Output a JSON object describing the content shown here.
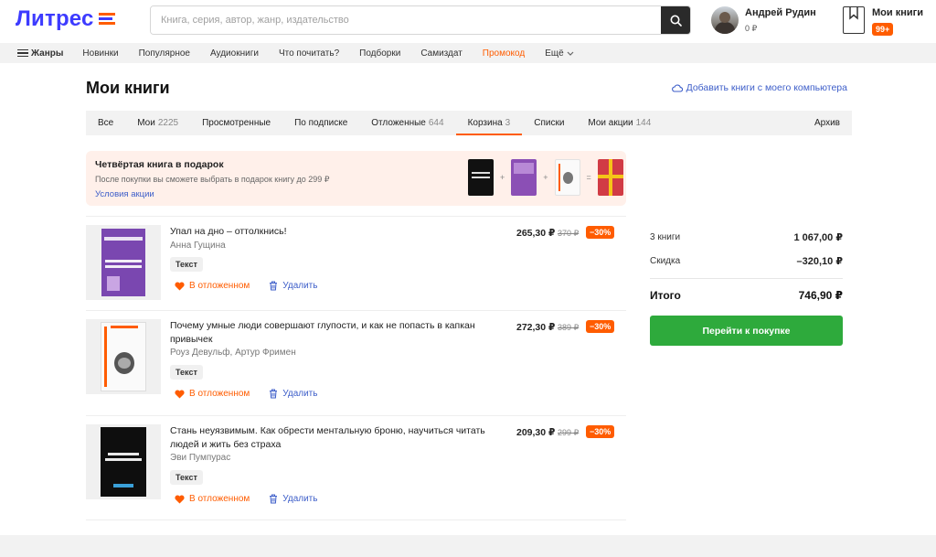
{
  "header": {
    "logo_text": "Литрес",
    "search_placeholder": "Книга, серия, автор, жанр, издательство",
    "user_name": "Андрей Рудин",
    "user_balance": "0 ₽",
    "mybooks_label": "Мои книги",
    "mybooks_badge": "99+"
  },
  "nav": {
    "genres": "Жанры",
    "items": [
      "Новинки",
      "Популярное",
      "Аудиокниги",
      "Что почитать?",
      "Подборки",
      "Самиздат"
    ],
    "promo": "Промокод",
    "more": "Ещё"
  },
  "page": {
    "title": "Мои книги",
    "add_link": "Добавить книги с моего компьютера"
  },
  "tabs": [
    {
      "label": "Все",
      "count": ""
    },
    {
      "label": "Мои",
      "count": "2225"
    },
    {
      "label": "Просмотренные",
      "count": ""
    },
    {
      "label": "По подписке",
      "count": ""
    },
    {
      "label": "Отложенные",
      "count": "644"
    },
    {
      "label": "Корзина",
      "count": "3"
    },
    {
      "label": "Списки",
      "count": ""
    },
    {
      "label": "Мои акции",
      "count": "144"
    }
  ],
  "tab_archive": "Архив",
  "promo": {
    "title": "Четвёртая книга в подарок",
    "subtitle": "После покупки вы сможете выбрать в подарок книгу до 299 ₽",
    "link": "Условия акции",
    "plus": "+",
    "equals": "="
  },
  "items": [
    {
      "title": "Упал на дно – оттолкнись!",
      "author": "Анна Гущина",
      "tag": "Текст",
      "price": "265,30 ₽",
      "old_price": "370 ₽",
      "discount": "−30%",
      "fav": "В отложенном",
      "delete": "Удалить"
    },
    {
      "title": "Почему умные люди совершают глупости, и как не попасть в капкан привычек",
      "author": "Роуз Девульф, Артур Фримен",
      "tag": "Текст",
      "price": "272,30 ₽",
      "old_price": "389 ₽",
      "discount": "−30%",
      "fav": "В отложенном",
      "delete": "Удалить"
    },
    {
      "title": "Стань неуязвимым. Как обрести ментальную броню, научиться читать людей и жить без страха",
      "author": "Эви Пумпурас",
      "tag": "Текст",
      "price": "209,30 ₽",
      "old_price": "299 ₽",
      "discount": "−30%",
      "fav": "В отложенном",
      "delete": "Удалить"
    }
  ],
  "summary": {
    "count_label": "3 книги",
    "count_value": "1 067,00 ₽",
    "discount_label": "Скидка",
    "discount_value": "–320,10 ₽",
    "total_label": "Итого",
    "total_value": "746,90 ₽",
    "buy_button": "Перейти к покупке"
  },
  "colors": {
    "brand": "#3d3bff",
    "accent": "#ff5c00",
    "link": "#3d5ec9",
    "buy": "#2eaa3c"
  }
}
